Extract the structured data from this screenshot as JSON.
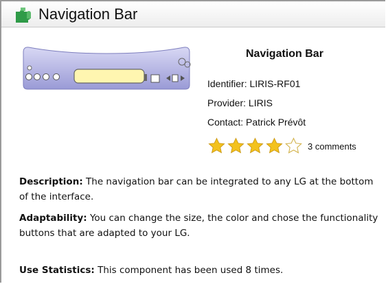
{
  "panel": {
    "title": "Navigation Bar",
    "icon": "puzzle-piece-icon"
  },
  "component": {
    "name": "Navigation Bar",
    "identifier": "Identifier: LIRIS-RF01",
    "provider": "Provider: LIRIS",
    "contact": "Contact: Patrick Prévôt",
    "rating": {
      "value": 4,
      "max": 5
    },
    "comments": "3 comments"
  },
  "details": {
    "description_label": "Description:",
    "description_text": "The navigation bar can be integrated to any LG at the bottom of the interface.",
    "adaptability_label": "Adaptability:",
    "adaptability_text": "You can change the size, the color and chose the functionality buttons that are adapted to your LG.",
    "stats_label": "Use Statistics:",
    "stats_text": "This component has been used 8 times."
  },
  "colors": {
    "star_fill": "#f3c21d",
    "thumb_body": "#b7b8e6",
    "thumb_field": "#fff6b0",
    "header_green": "#2f9b48"
  }
}
